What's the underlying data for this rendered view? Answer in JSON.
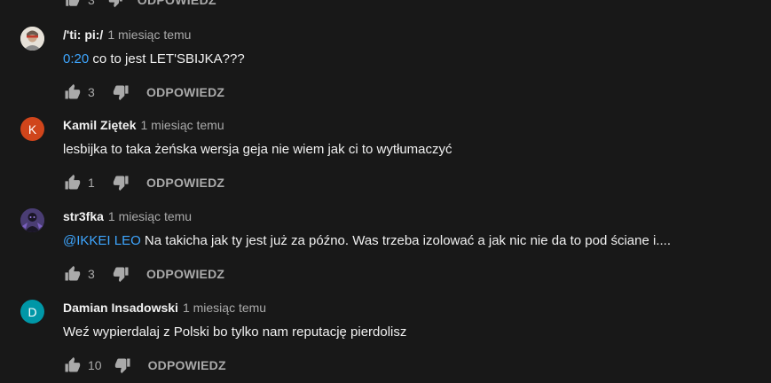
{
  "comments": [
    {
      "author": "/'ti: pi:/",
      "time": "1 miesiąc temu",
      "link": "0:20",
      "text": " co to jest LET'SBIJKA???",
      "likes": "3",
      "reply_label": "ODPOWIEDZ",
      "avatar_type": "photo"
    },
    {
      "author": "Kamil Ziętek",
      "time": "1 miesiąc temu",
      "link": "",
      "text": "lesbijka to taka żeńska wersja geja nie wiem jak ci to wytłumaczyć",
      "likes": "1",
      "reply_label": "ODPOWIEDZ",
      "avatar_letter": "K",
      "avatar_color": "#d0451b"
    },
    {
      "author": "str3fka",
      "time": "1 miesiąc temu",
      "link": "@IKKEI LEO",
      "text": " Na takicha jak ty jest już za późno. Was trzeba izolować a jak nic nie da to pod ściane i....",
      "likes": "3",
      "reply_label": "ODPOWIEDZ",
      "avatar_type": "photo"
    },
    {
      "author": "Damian Insadowski",
      "time": "1 miesiąc temu",
      "link": "",
      "text": "Weź wypierdalaj z Polski bo tylko nam reputację pierdolisz",
      "likes": "10",
      "reply_label": "ODPOWIEDZ",
      "avatar_letter": "D",
      "avatar_color": "#0097a7"
    }
  ],
  "top_partial": {
    "likes": "3",
    "reply_label": "ODPOWIEDZ"
  }
}
